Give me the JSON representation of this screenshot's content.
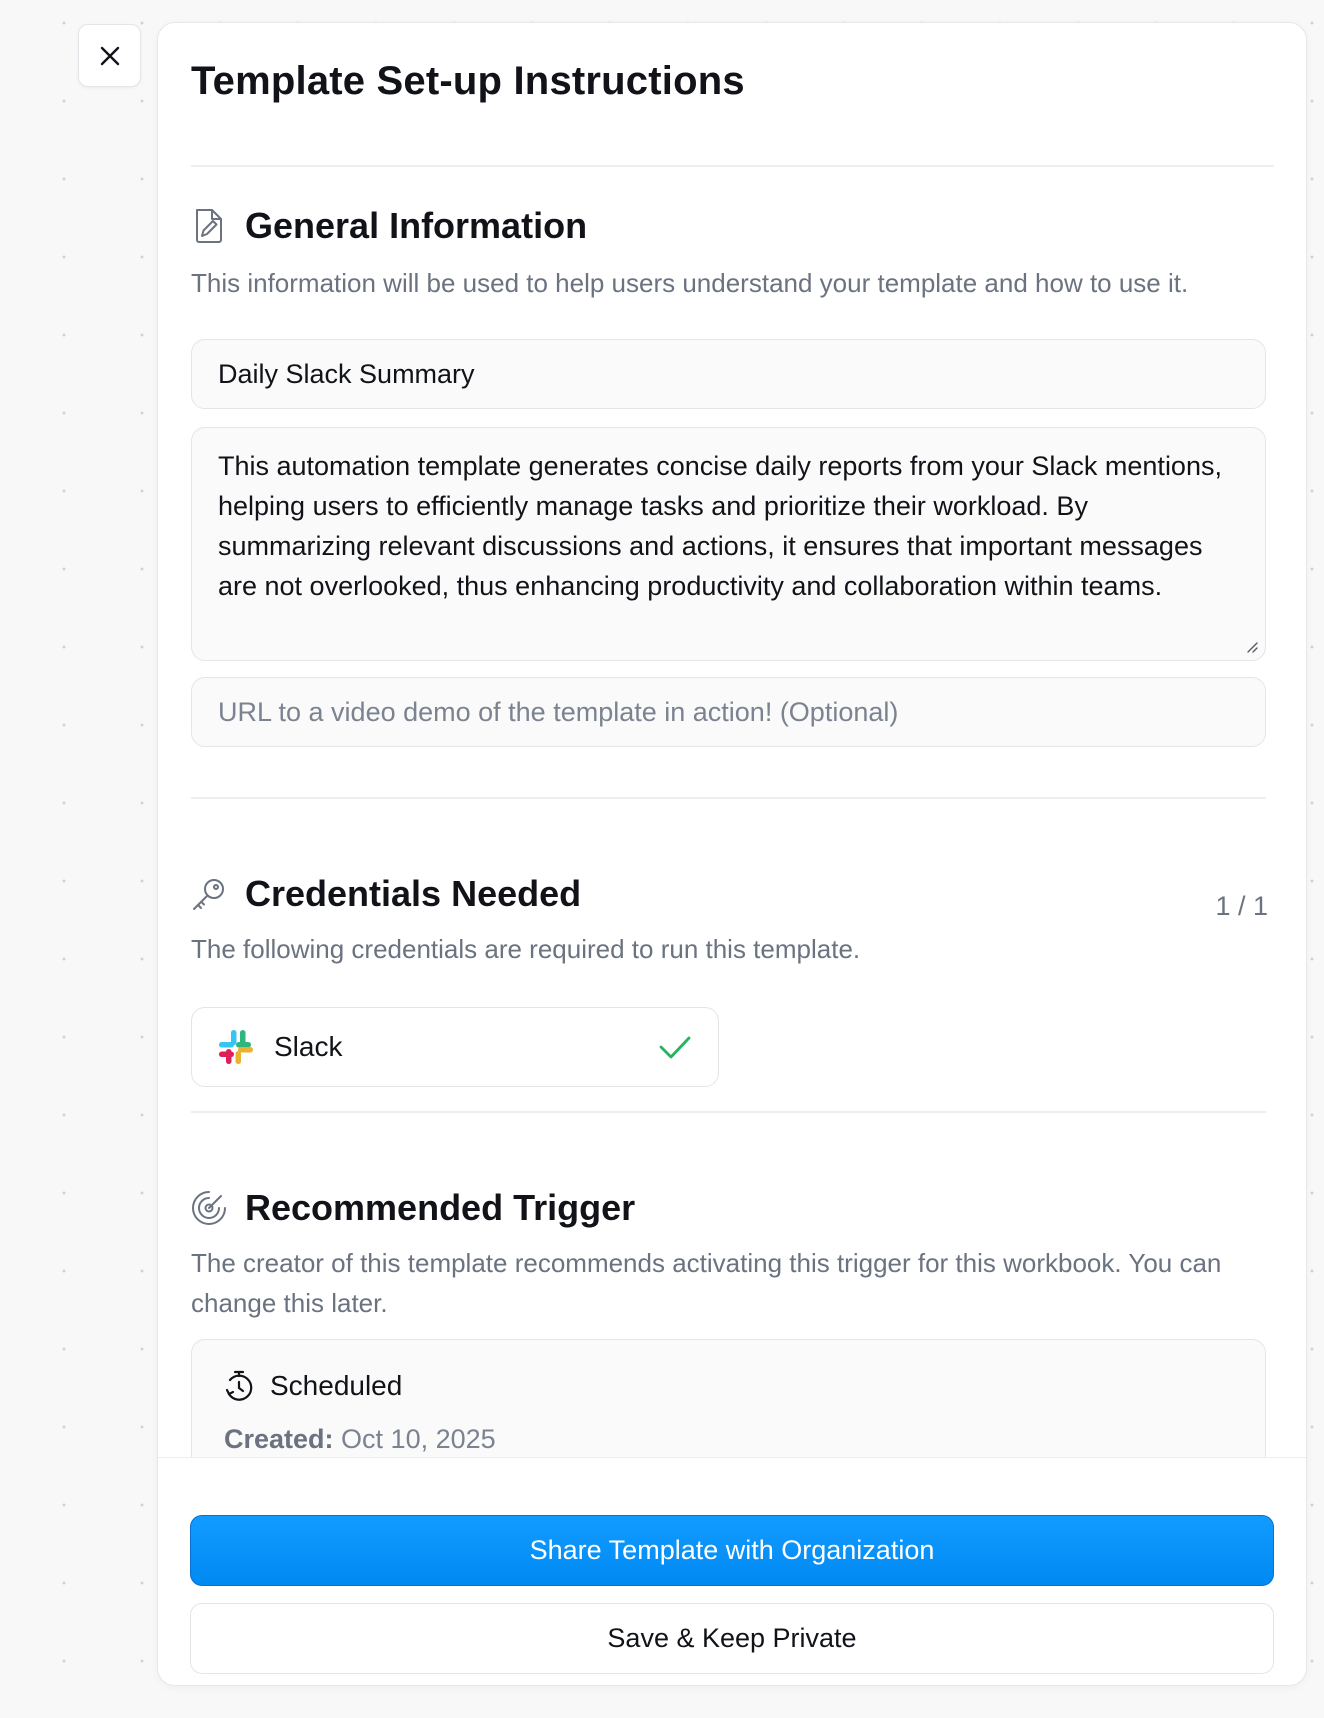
{
  "close_button": {
    "icon": "close-icon"
  },
  "panel": {
    "title": "Template Set-up Instructions"
  },
  "general": {
    "icon": "file-edit-icon",
    "title": "General Information",
    "description": "This information will be used to help users understand your template and how to use it.",
    "name_value": "Daily Slack Summary",
    "description_value": "This automation template generates concise daily reports from your Slack mentions, helping users to efficiently manage tasks and prioritize their workload. By summarizing relevant discussions and actions, it ensures that important messages are not overlooked, thus enhancing productivity and collaboration within teams.",
    "video_placeholder": "URL to a video demo of the template in action! (Optional)"
  },
  "credentials": {
    "icon": "key-icon",
    "title": "Credentials Needed",
    "counter": "1 / 1",
    "description": "The following credentials are required to run this template.",
    "items": [
      {
        "label": "Slack",
        "icon": "slack-logo-icon",
        "status": "check-icon"
      }
    ]
  },
  "trigger": {
    "icon": "radar-icon",
    "title": "Recommended Trigger",
    "description": "The creator of this template recommends activating this trigger for this workbook. You can change this later.",
    "card": {
      "icon": "timer-icon",
      "name": "Scheduled",
      "created_label": "Created:",
      "created_value": "Oct 10, 2025"
    }
  },
  "footer": {
    "primary_label": "Share Template with Organization",
    "secondary_label": "Save & Keep Private"
  },
  "colors": {
    "primary": "#0a8ff5",
    "success": "#22b55e",
    "muted_text": "#6b7280"
  }
}
